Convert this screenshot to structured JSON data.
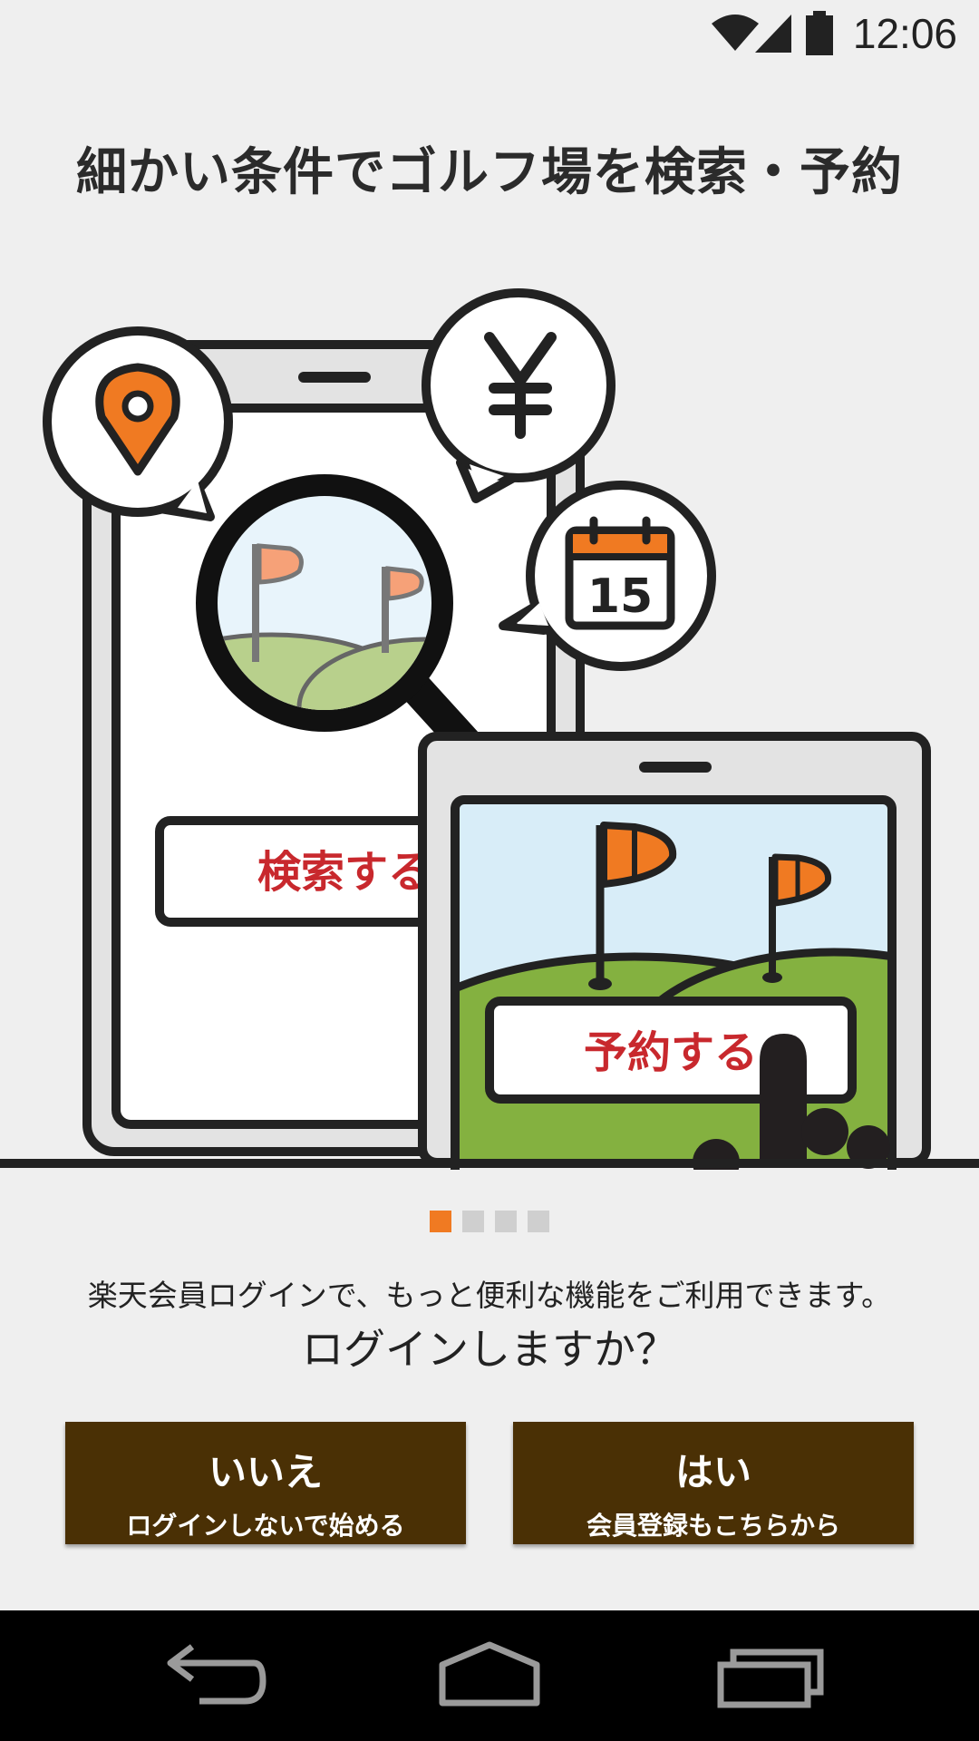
{
  "status_bar": {
    "time": "12:06",
    "icons": [
      "wifi-icon",
      "cell-signal-icon",
      "battery-icon"
    ]
  },
  "tutorial": {
    "headline": "細かい条件でゴルフ場を検索・予約",
    "illustration": {
      "search_button_label": "検索する",
      "reserve_button_label": "予約する",
      "calendar_day": "15",
      "icons": [
        "location-pin-icon",
        "yen-icon",
        "calendar-icon",
        "magnifier-icon",
        "golf-flag-icon"
      ]
    },
    "page_indicator": {
      "total": 4,
      "current": 1
    }
  },
  "login_prompt": {
    "message": "楽天会員ログインで、もっと便利な機能をご利用できます。",
    "question": "ログインしますか？",
    "no_button": {
      "label": "いいえ",
      "sublabel": "ログインしないで始める"
    },
    "yes_button": {
      "label": "はい",
      "sublabel": "会員登録もこちらから"
    }
  },
  "colors": {
    "accent_orange": "#f07a22",
    "button_brown": "#4a3005",
    "label_red": "#c8282d",
    "grass_green": "#84b140",
    "sky_blue": "#d8edf8"
  }
}
